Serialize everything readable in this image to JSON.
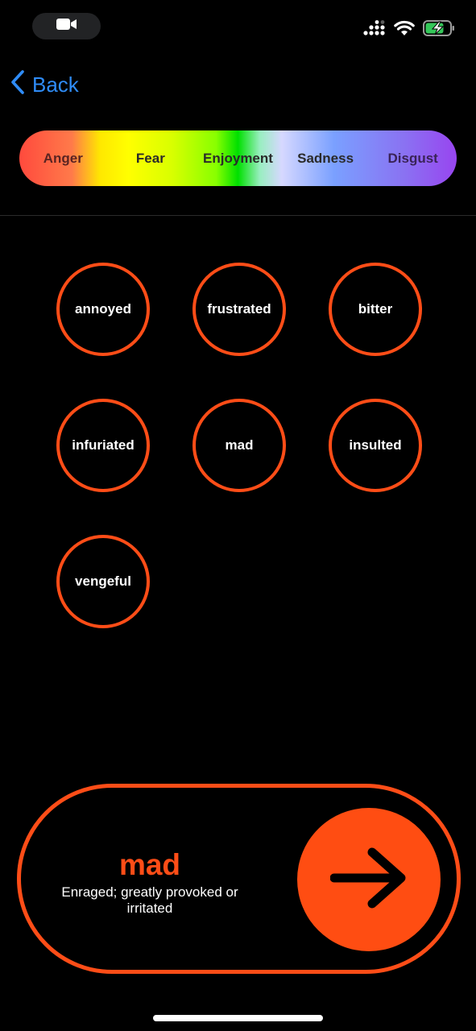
{
  "status_bar": {
    "icons": [
      "video-camera-icon",
      "cellular-signal-icon",
      "wifi-icon",
      "battery-charging-icon"
    ]
  },
  "nav": {
    "back_label": "Back",
    "back_icon": "chevron-left-icon"
  },
  "spectrum": {
    "items": [
      {
        "label": "Anger"
      },
      {
        "label": "Fear"
      },
      {
        "label": "Enjoyment"
      },
      {
        "label": "Sadness"
      },
      {
        "label": "Disgust"
      }
    ]
  },
  "feelings": {
    "items": [
      {
        "label": "annoyed"
      },
      {
        "label": "frustrated"
      },
      {
        "label": "bitter"
      },
      {
        "label": "infuriated"
      },
      {
        "label": "mad"
      },
      {
        "label": "insulted"
      },
      {
        "label": "vengeful"
      }
    ]
  },
  "selection": {
    "word": "mad",
    "definition": "Enraged; greatly provoked or irritated",
    "go_icon": "arrow-right-icon"
  },
  "colors": {
    "accent": "#ff4d17",
    "link": "#2f8cf7",
    "background": "#000000"
  }
}
